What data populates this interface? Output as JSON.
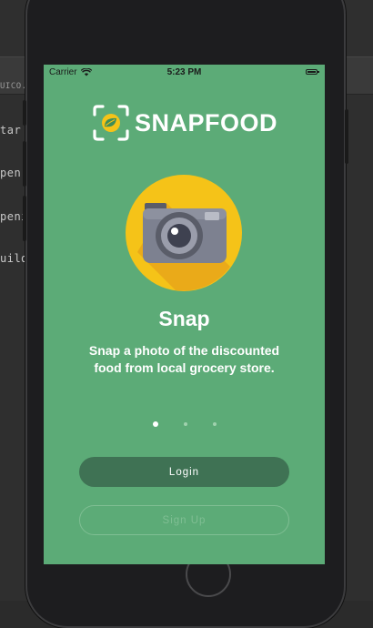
{
  "background_editor": {
    "tab_fragment": "UICO...",
    "code_fragments": [
      "tar",
      "pen:",
      "peni",
      "uild"
    ]
  },
  "status_bar": {
    "carrier": "Carrier",
    "time": "5:23 PM"
  },
  "app": {
    "logo_text": "SNAPFOOD",
    "onboarding": {
      "title": "Snap",
      "description": "Snap a photo of the discounted food from local grocery store.",
      "page_count": 3,
      "active_page": 1
    },
    "login_label": "Login",
    "signup_label": "Sign Up"
  },
  "colors": {
    "screen_background": "#5cab77",
    "login_button": "#3f7254",
    "signup_outline": "#7fbe93",
    "illustration_circle": "#f5c318"
  },
  "icons": {
    "logo": "camera-leaf-logo-icon",
    "illustration": "camera-icon"
  }
}
